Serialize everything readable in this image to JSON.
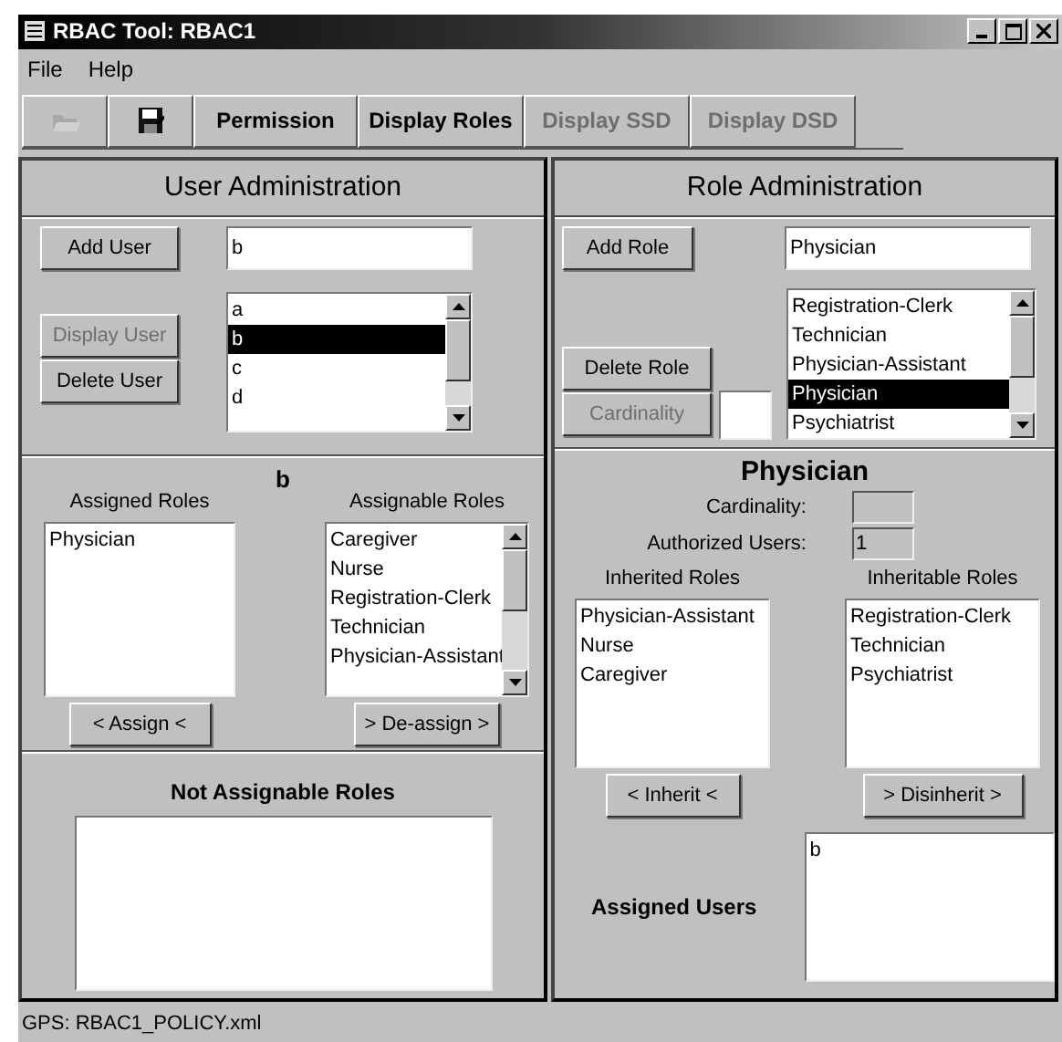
{
  "window": {
    "title": "RBAC Tool: RBAC1"
  },
  "menu": [
    {
      "label": "File"
    },
    {
      "label": "Help"
    }
  ],
  "toolbar": [
    {
      "kind": "open",
      "disabled": true
    },
    {
      "kind": "save",
      "disabled": false
    },
    {
      "kind": "text",
      "label": "Permission",
      "disabled": false
    },
    {
      "kind": "text",
      "label": "Display Roles",
      "disabled": false
    },
    {
      "kind": "text",
      "label": "Display SSD",
      "disabled": true
    },
    {
      "kind": "text",
      "label": "Display DSD",
      "disabled": true
    }
  ],
  "user_admin": {
    "title": "User Administration",
    "add_button": {
      "label": "Add User",
      "disabled": false
    },
    "user_field": {
      "value": "b"
    },
    "display_button": {
      "label": "Display User",
      "disabled": true
    },
    "delete_button": {
      "label": "Delete User",
      "disabled": false
    },
    "users": [
      {
        "label": "a",
        "selected": false
      },
      {
        "label": "b",
        "selected": true
      },
      {
        "label": "c",
        "selected": false
      },
      {
        "label": "d",
        "selected": false
      }
    ]
  },
  "user_detail": {
    "title": "b",
    "assigned_label": "Assigned Roles",
    "assigned": [
      "Physician"
    ],
    "assignable_label": "Assignable Roles",
    "assignable": [
      "Caregiver",
      "Nurse",
      "Registration-Clerk",
      "Technician",
      "Physician-Assistant"
    ],
    "assign_button": {
      "label": "< Assign <",
      "disabled": false
    },
    "deassign_button": {
      "label": "> De-assign >",
      "disabled": false
    }
  },
  "not_assignable": {
    "title": "Not Assignable Roles"
  },
  "role_admin": {
    "title": "Role Administration",
    "add_button": {
      "label": "Add Role",
      "disabled": false
    },
    "role_field": {
      "value": "Physician"
    },
    "delete_button": {
      "label": "Delete Role",
      "disabled": false
    },
    "cardinality_button": {
      "label": "Cardinality",
      "disabled": true
    },
    "roles": [
      {
        "label": "Registration-Clerk",
        "selected": false
      },
      {
        "label": "Technician",
        "selected": false
      },
      {
        "label": "Physician-Assistant",
        "selected": false
      },
      {
        "label": "Physician",
        "selected": true
      },
      {
        "label": "Psychiatrist",
        "selected": false
      }
    ]
  },
  "role_detail": {
    "title": "Physician",
    "cardinality_label": "Cardinality:",
    "authorized_label": "Authorized Users:",
    "authorized_value": "1",
    "inherited_label": "Inherited Roles",
    "inherited": [
      "Physician-Assistant",
      "Nurse",
      "Caregiver"
    ],
    "inheritable_label": "Inheritable Roles",
    "inheritable": [
      "Registration-Clerk",
      "Technician",
      "Psychiatrist"
    ],
    "inherit_button": {
      "label": "< Inherit <",
      "disabled": false
    },
    "disinherit_button": {
      "label": "> Disinherit >",
      "disabled": false
    },
    "assigned_users_label": "Assigned Users",
    "assigned_users": [
      "b"
    ]
  },
  "status_bar": {
    "text": "GPS: RBAC1_POLICY.xml"
  }
}
